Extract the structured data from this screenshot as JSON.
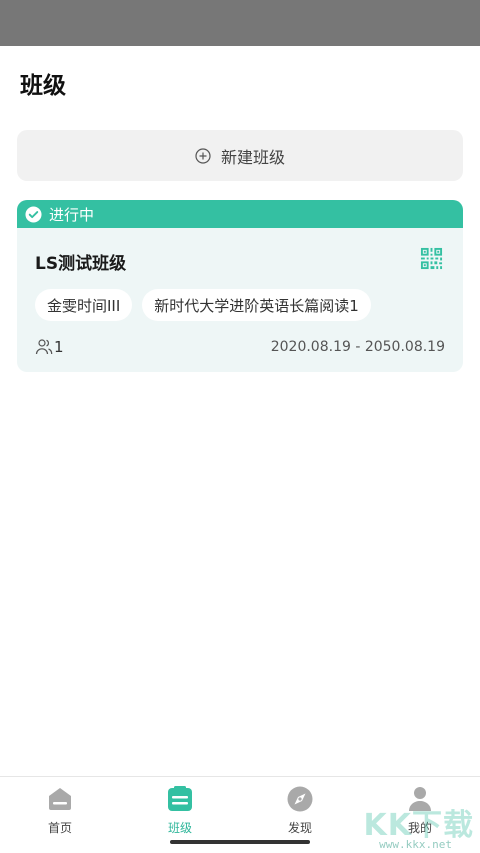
{
  "header": {
    "title": "班级"
  },
  "new_class": {
    "label": "新建班级"
  },
  "class_card": {
    "status": "进行中",
    "title": "LS测试班级",
    "tags": [
      "金雯时间III",
      "新时代大学进阶英语长篇阅读1"
    ],
    "member_count": "1",
    "date_range": "2020.08.19 - 2050.08.19"
  },
  "tabbar": {
    "items": [
      {
        "label": "首页",
        "icon": "home-icon"
      },
      {
        "label": "班级",
        "icon": "class-icon",
        "active": true
      },
      {
        "label": "发现",
        "icon": "compass-icon"
      },
      {
        "label": "我的",
        "icon": "profile-icon"
      }
    ]
  },
  "watermark": {
    "text": "KK下载",
    "sub": "www.kkx.net"
  },
  "colors": {
    "accent": "#34c0a2",
    "card_bg": "#eef6f6",
    "button_bg": "#f1f1f1"
  }
}
